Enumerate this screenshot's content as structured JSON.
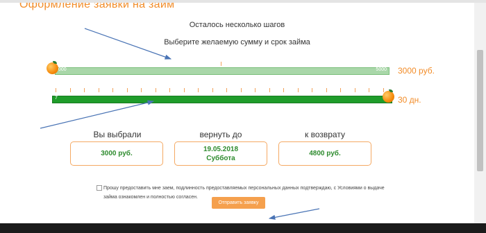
{
  "page": {
    "title": "Оформление заявки на займ",
    "subtitle": "Осталось несколько шагов",
    "instruction": "Выберите желаемую сумму и срок займа"
  },
  "amount_slider": {
    "min_label": "000",
    "max_label": "5000",
    "value_text": "3000 руб."
  },
  "term_slider": {
    "min_label": "7",
    "value_text": "30 дн."
  },
  "summary": {
    "selected": {
      "label": "Вы выбрали",
      "value": "3000 руб."
    },
    "return_date": {
      "label": "вернуть до",
      "date": "19.05.2018",
      "day": "Суббота"
    },
    "repay": {
      "label": "к возврату",
      "value": "4800 руб."
    }
  },
  "agreement": {
    "text": "Прошу предоставить мне заем, подлинность предоставляемых персональных данных подтверждаю, с Условиями о выдаче займа ознакомлен и полностью согласен.",
    "checked": false
  },
  "submit": {
    "label": "Отправить заявку"
  },
  "colors": {
    "accent": "#f28c28",
    "green": "#1f9c2a",
    "light_green": "#a9d7a9",
    "button": "#f5a04d",
    "arrow": "#4a74b5"
  }
}
